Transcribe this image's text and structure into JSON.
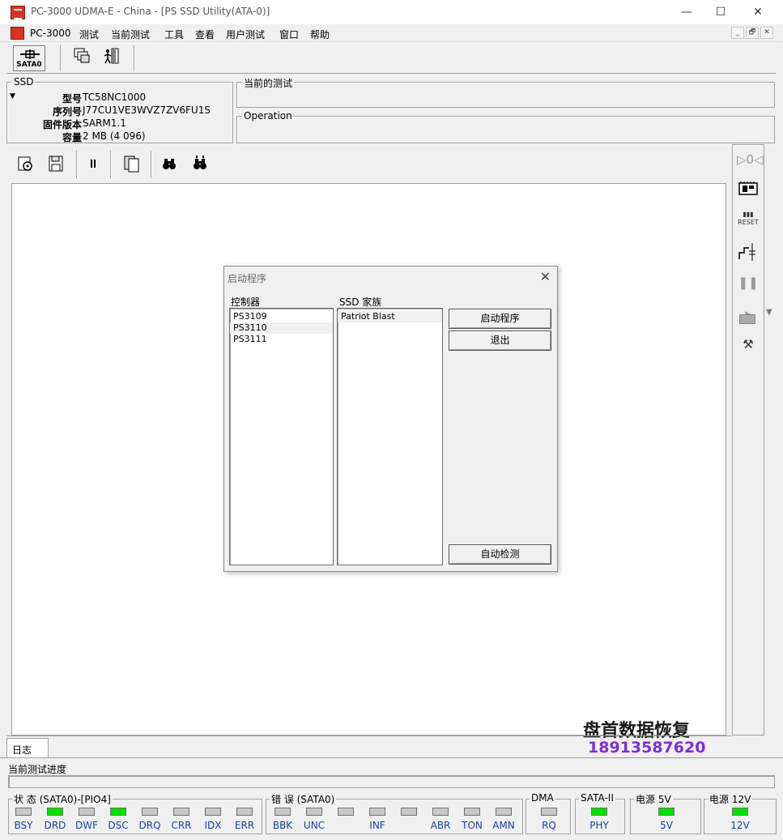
{
  "window": {
    "title": "PC-3000 UDMA-E - China - [PS SSD Utility(ATA-0)]",
    "min": "—",
    "max": "☐",
    "close": "✕"
  },
  "menu": [
    "PC-3000",
    "测试",
    "当前测试",
    "工具",
    "查看",
    "用户测试",
    "窗口",
    "帮助"
  ],
  "mdi": {
    "min": "_",
    "restore": "🗗",
    "close": "✕"
  },
  "toolbar": {
    "sata_label": "SATA0"
  },
  "ssd": {
    "group_title": "SSD",
    "rows": [
      {
        "label": "型号",
        "value": "TC58NC1000"
      },
      {
        "label": "序列号",
        "value": "J77CU1VE3WVZ7ZV6FU1S"
      },
      {
        "label": "固件版本",
        "value": "SARM1.1"
      },
      {
        "label": "容量",
        "value": "2 MB (4 096)"
      }
    ]
  },
  "current_test": {
    "title": "当前的测试"
  },
  "operation": {
    "title": "Operation"
  },
  "dialog": {
    "title": "启动程序",
    "controller_label": "控制器",
    "controllers": [
      "PS3109",
      "PS3110",
      "PS3111"
    ],
    "controller_selected": 1,
    "family_label": "SSD 家族",
    "families": [
      "Patriot Blast"
    ],
    "start_button": "启动程序",
    "exit_button": "退出",
    "auto_button": "自动检测"
  },
  "log_tab": "日志",
  "progress_label": "当前测试进度",
  "watermark": {
    "company": "盘首数据恢复",
    "phone": "18913587620"
  },
  "status": {
    "state_title": "状 态 (SATA0)-[PIO4]",
    "state_leds": [
      {
        "label": "BSY",
        "on": false
      },
      {
        "label": "DRD",
        "on": true
      },
      {
        "label": "DWF",
        "on": false
      },
      {
        "label": "DSC",
        "on": true
      },
      {
        "label": "DRQ",
        "on": false
      },
      {
        "label": "CRR",
        "on": false
      },
      {
        "label": "IDX",
        "on": false
      },
      {
        "label": "ERR",
        "on": false
      }
    ],
    "error_title": "错 误 (SATA0)",
    "error_leds": [
      {
        "label": "BBK",
        "on": false
      },
      {
        "label": "UNC",
        "on": false
      },
      {
        "label": "",
        "on": false
      },
      {
        "label": "INF",
        "on": false
      },
      {
        "label": "",
        "on": false
      },
      {
        "label": "ABR",
        "on": false
      },
      {
        "label": "TON",
        "on": false
      },
      {
        "label": "AMN",
        "on": false
      }
    ],
    "dma_title": "DMA",
    "dma_leds": [
      {
        "label": "RQ",
        "on": false
      }
    ],
    "sata_title": "SATA-II",
    "sata_leds": [
      {
        "label": "PHY",
        "on": true
      }
    ],
    "p5_title": "电源 5V",
    "p5_leds": [
      {
        "label": "5V",
        "on": true
      }
    ],
    "p12_title": "电源 12V",
    "p12_leds": [
      {
        "label": "12V",
        "on": true
      }
    ]
  },
  "colors": {
    "led_on": "#00e000",
    "led_off": "#c8c8c8",
    "led_label": "#1a3fa0",
    "watermark_phone": "#7b2fd6"
  }
}
